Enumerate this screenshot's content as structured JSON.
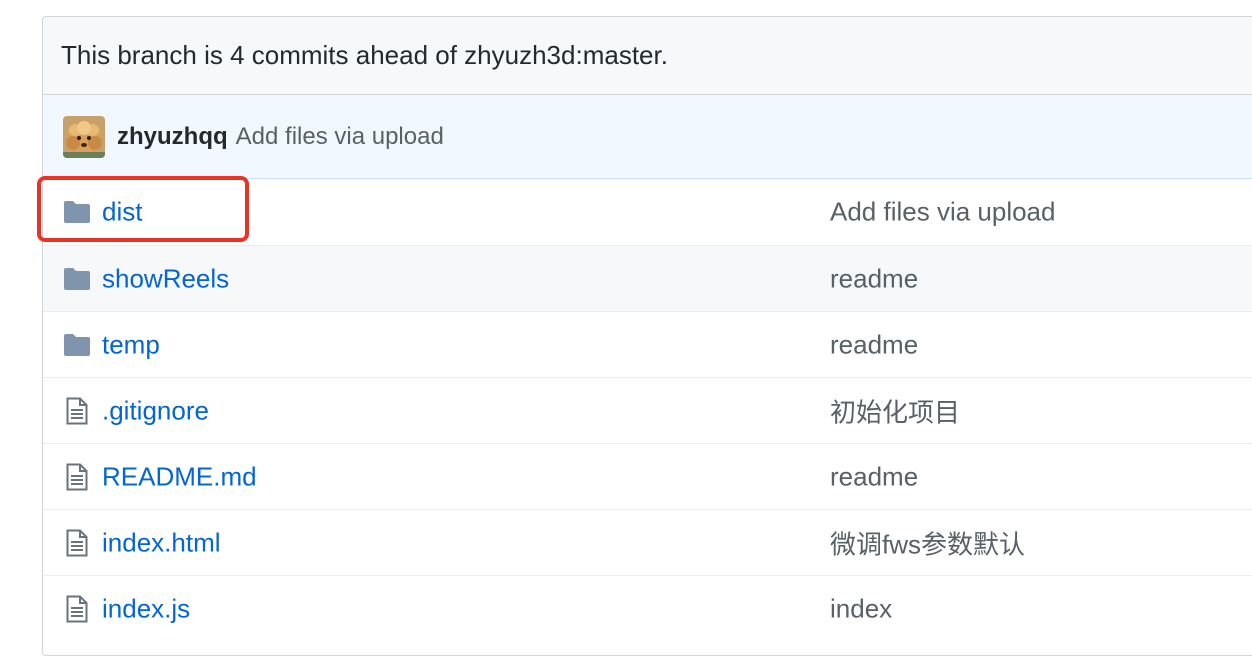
{
  "branch_info": {
    "text": "This branch is 4 commits ahead of zhyuzh3d:master."
  },
  "latest_commit": {
    "author": "zhyuzhqq",
    "message": "Add files via upload"
  },
  "files": [
    {
      "name": "dist",
      "type": "folder",
      "icon": "folder-icon",
      "commit": "Add files via upload"
    },
    {
      "name": "showReels",
      "type": "folder",
      "icon": "folder-icon",
      "commit": "readme"
    },
    {
      "name": "temp",
      "type": "folder",
      "icon": "folder-icon",
      "commit": "readme"
    },
    {
      "name": ".gitignore",
      "type": "file",
      "icon": "file-text-icon",
      "commit": "初始化项目"
    },
    {
      "name": "README.md",
      "type": "file",
      "icon": "file-text-icon",
      "commit": "readme"
    },
    {
      "name": "index.html",
      "type": "file",
      "icon": "file-text-icon",
      "commit": "微调fws参数默认"
    },
    {
      "name": "index.js",
      "type": "file",
      "icon": "file-text-icon",
      "commit": "index"
    }
  ],
  "colors": {
    "link": "#0366d6",
    "muted": "#586069",
    "folder": "#79b8ff",
    "highlight": "#ea3323"
  }
}
